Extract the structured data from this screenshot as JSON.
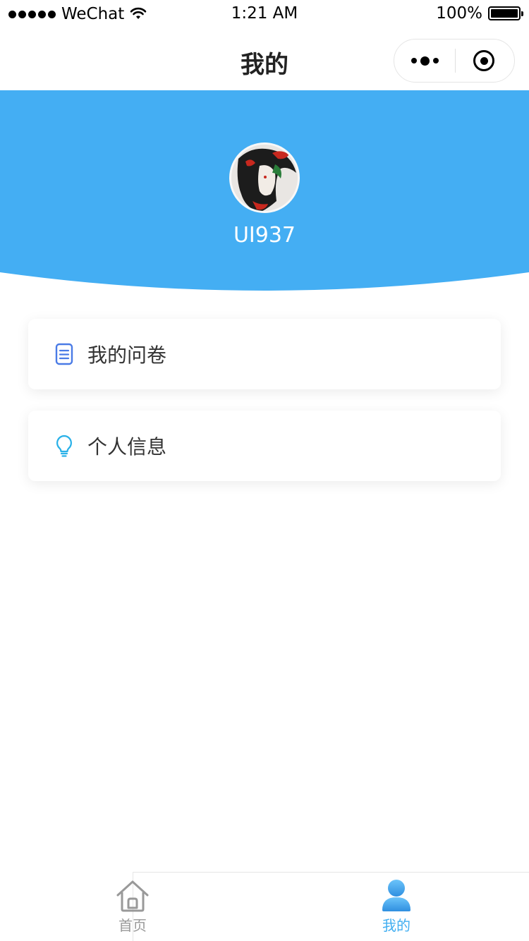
{
  "status_bar": {
    "carrier": "WeChat",
    "time": "1:21 AM",
    "battery": "100%"
  },
  "nav": {
    "title": "我的"
  },
  "profile": {
    "username": "UI937"
  },
  "menu": [
    {
      "label": "我的问卷",
      "icon": "document-icon"
    },
    {
      "label": "个人信息",
      "icon": "lightbulb-icon"
    }
  ],
  "tabbar": {
    "items": [
      {
        "label": "首页",
        "icon": "home-icon",
        "active": false
      },
      {
        "label": "我的",
        "icon": "user-icon",
        "active": true
      }
    ]
  },
  "colors": {
    "accent": "#42aef1",
    "header_bg": "#44aef3",
    "text_primary": "#333333",
    "tab_inactive": "#999999"
  }
}
